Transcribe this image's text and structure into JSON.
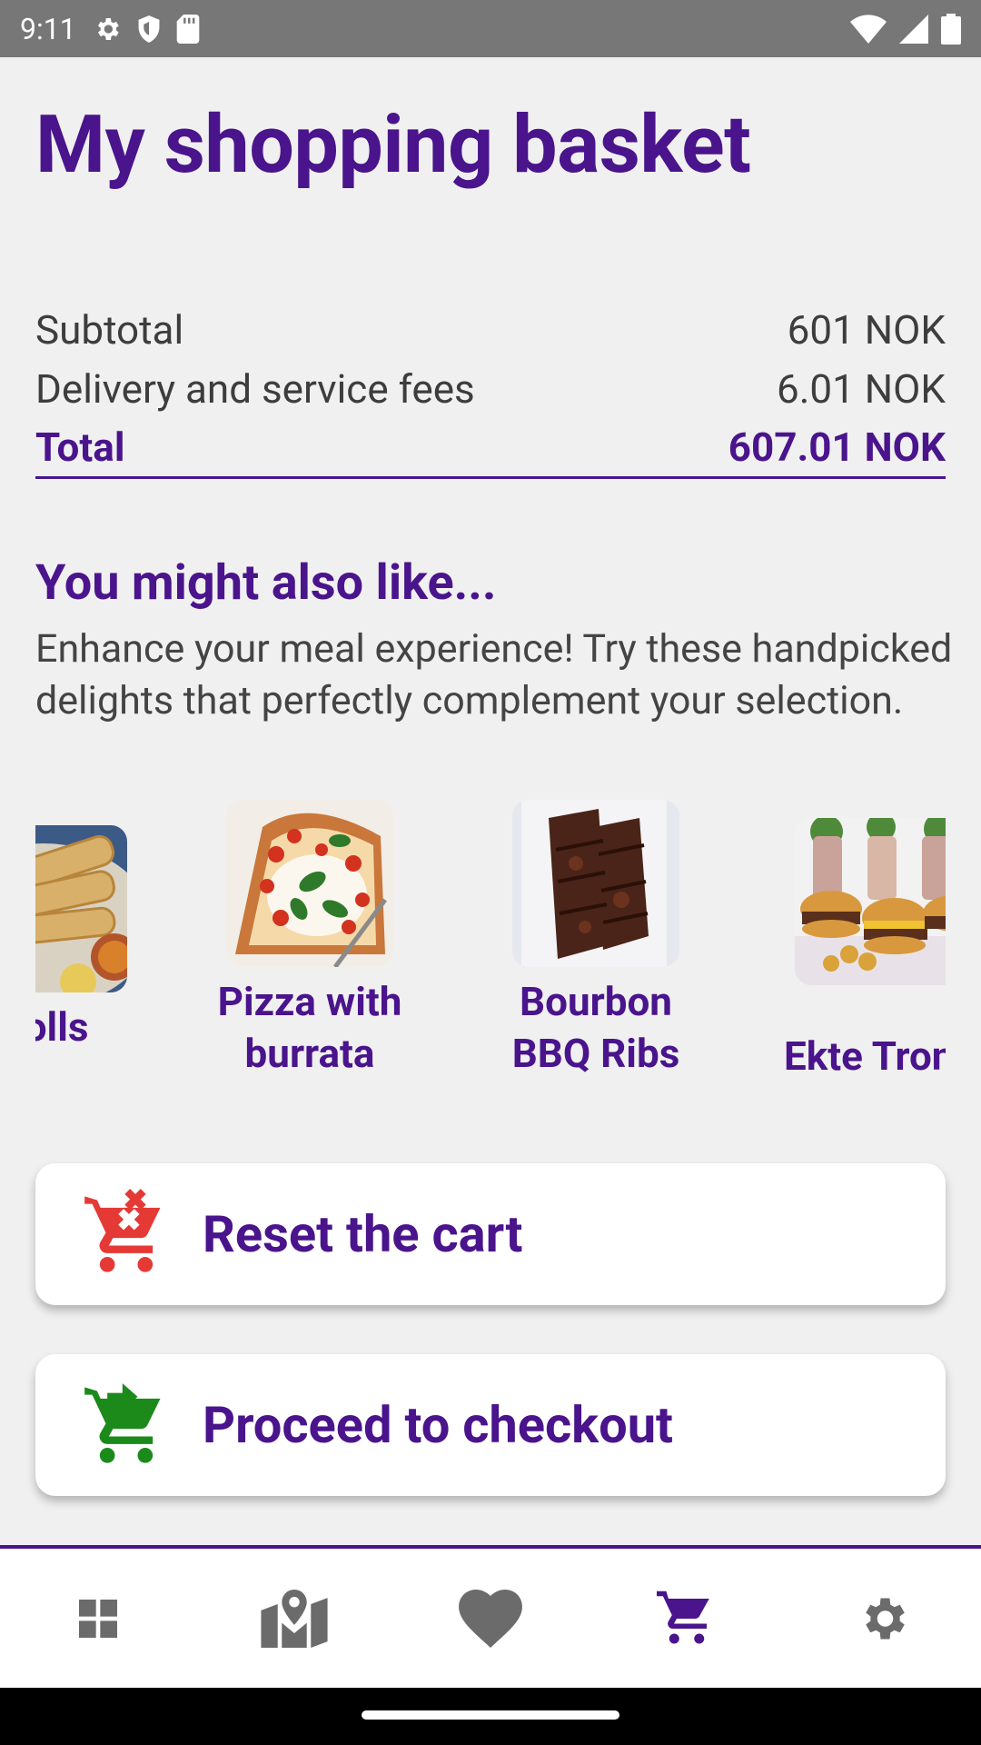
{
  "status_bar": {
    "time": "9:11"
  },
  "page": {
    "title": "My shopping basket"
  },
  "summary": {
    "subtotal_label": "Subtotal",
    "subtotal_value": "601 NOK",
    "fees_label": "Delivery and service fees",
    "fees_value": "6.01 NOK",
    "total_label": "Total",
    "total_value": "607.01 NOK"
  },
  "suggestions": {
    "title": "You might also like...",
    "description": "Enhance your meal experience! Try these handpicked delights that perfectly complement your selection.",
    "items": [
      {
        "name": "Rolls"
      },
      {
        "name": "Pizza with burrata"
      },
      {
        "name": "Bourbon BBQ Ribs"
      },
      {
        "name": "Ekte Tron"
      }
    ]
  },
  "buttons": {
    "reset_label": "Reset the cart",
    "checkout_label": "Proceed to checkout"
  },
  "colors": {
    "accent": "#4a148c",
    "reset_icon": "#e53935",
    "checkout_icon": "#1b8a1b",
    "nav_inactive": "#6b6b6b"
  },
  "bottom_nav": [
    {
      "icon": "grid-icon",
      "active": false
    },
    {
      "icon": "map-icon",
      "active": false
    },
    {
      "icon": "heart-icon",
      "active": false
    },
    {
      "icon": "cart-icon",
      "active": true
    },
    {
      "icon": "gear-icon",
      "active": false
    }
  ]
}
